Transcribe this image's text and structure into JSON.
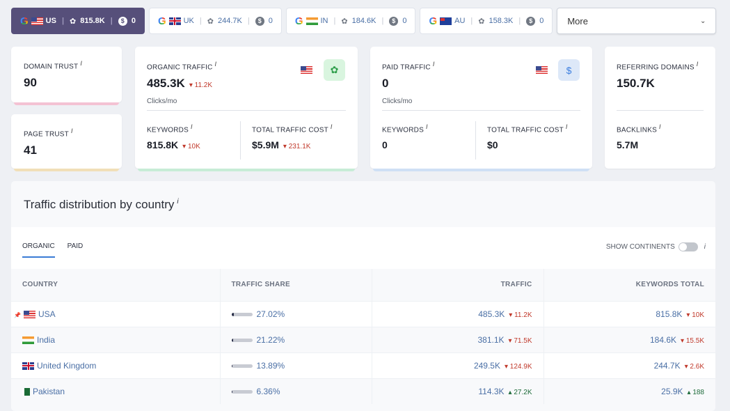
{
  "db_tabs": [
    {
      "engine": "G",
      "flag": "us",
      "code": "US",
      "keywords": "815.8K",
      "paid": "0",
      "active": true
    },
    {
      "engine": "G",
      "flag": "uk",
      "code": "UK",
      "keywords": "244.7K",
      "paid": "0",
      "active": false
    },
    {
      "engine": "G",
      "flag": "in",
      "code": "IN",
      "keywords": "184.6K",
      "paid": "0",
      "active": false
    },
    {
      "engine": "G",
      "flag": "au",
      "code": "AU",
      "keywords": "158.3K",
      "paid": "0",
      "active": false
    }
  ],
  "more_select": {
    "label": "More",
    "icon": "chevron-down-icon"
  },
  "info_glyph": "i",
  "domain_trust": {
    "label": "DOMAIN TRUST",
    "value": "90",
    "accent": "#f4c2d3"
  },
  "page_trust": {
    "label": "PAGE TRUST",
    "value": "41",
    "accent": "#f1dfb8"
  },
  "organic": {
    "label": "ORGANIC TRAFFIC",
    "value": "485.3K",
    "change": "11.2K",
    "unit": "Clicks/mo",
    "keywords_label": "KEYWORDS",
    "keywords": "815.8K",
    "keywords_change": "10K",
    "cost_label": "TOTAL TRAFFIC COST",
    "cost": "$5.9M",
    "cost_change": "231.1K",
    "accent": "#c7ecd6",
    "icon": "leaf-icon"
  },
  "paid": {
    "label": "PAID TRAFFIC",
    "value": "0",
    "unit": "Clicks/mo",
    "keywords_label": "KEYWORDS",
    "keywords": "0",
    "cost_label": "TOTAL TRAFFIC COST",
    "cost": "$0",
    "accent": "#cfe0f5",
    "icon": "dollar-icon",
    "icon_glyph": "$"
  },
  "referring": {
    "label": "REFERRING DOMAINS",
    "value": "150.7K",
    "backlinks_label": "BACKLINKS",
    "backlinks": "5.7M"
  },
  "distribution": {
    "title": "Traffic distribution by country",
    "tabs": [
      {
        "label": "ORGANIC",
        "active": true
      },
      {
        "label": "PAID",
        "active": false
      }
    ],
    "toggle_label": "SHOW CONTINENTS",
    "toggle_on": false,
    "columns": [
      "COUNTRY",
      "TRAFFIC SHARE",
      "TRAFFIC",
      "KEYWORDS TOTAL"
    ],
    "rows": [
      {
        "flag": "us",
        "country": "USA",
        "pinned": true,
        "share": "27.02%",
        "share_pct": 27.02,
        "traffic": "485.3K",
        "traffic_change": "11.2K",
        "traffic_dir": "down",
        "keywords": "815.8K",
        "keywords_change": "10K",
        "keywords_dir": "down"
      },
      {
        "flag": "in",
        "country": "India",
        "pinned": false,
        "share": "21.22%",
        "share_pct": 21.22,
        "traffic": "381.1K",
        "traffic_change": "71.5K",
        "traffic_dir": "down",
        "keywords": "184.6K",
        "keywords_change": "15.5K",
        "keywords_dir": "down"
      },
      {
        "flag": "uk",
        "country": "United Kingdom",
        "pinned": false,
        "share": "13.89%",
        "share_pct": 13.89,
        "traffic": "249.5K",
        "traffic_change": "124.9K",
        "traffic_dir": "down",
        "keywords": "244.7K",
        "keywords_change": "2.6K",
        "keywords_dir": "down"
      },
      {
        "flag": "pk",
        "country": "Pakistan",
        "pinned": false,
        "share": "6.36%",
        "share_pct": 6.36,
        "traffic": "114.3K",
        "traffic_change": "27.2K",
        "traffic_dir": "up",
        "keywords": "25.9K",
        "keywords_change": "188",
        "keywords_dir": "up"
      }
    ]
  }
}
